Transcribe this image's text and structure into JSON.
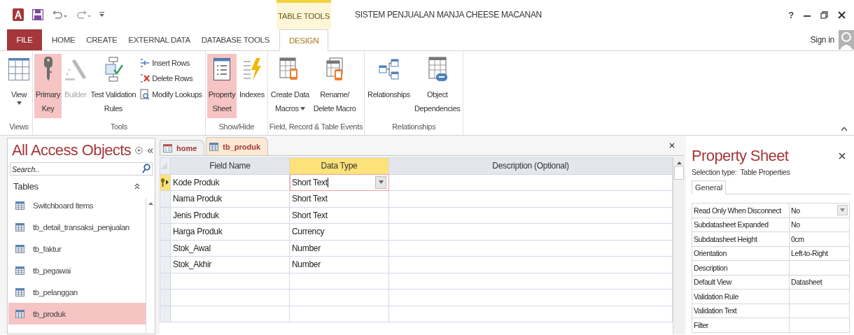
{
  "title_bar": {
    "contextual_tab": "TABLE TOOLS",
    "title": "SISTEM PENJUALAN MANJA CHEESE MACANAN",
    "help": "?"
  },
  "tabs": [
    {
      "label": "FILE",
      "kind": "file",
      "selected": false
    },
    {
      "label": "HOME",
      "kind": "tab",
      "selected": false
    },
    {
      "label": "CREATE",
      "kind": "tab",
      "selected": false
    },
    {
      "label": "EXTERNAL DATA",
      "kind": "tab",
      "selected": false
    },
    {
      "label": "DATABASE TOOLS",
      "kind": "tab",
      "selected": false
    },
    {
      "label": "DESIGN",
      "kind": "tab",
      "selected": true
    }
  ],
  "sign_in": "Sign in",
  "ribbon": {
    "groups": [
      {
        "label": "Views",
        "commands": [
          {
            "kind": "large",
            "lines": [
              "View"
            ],
            "dropdown": true,
            "on": false,
            "disabled": false
          }
        ]
      },
      {
        "label": "Tools",
        "commands": [
          {
            "kind": "large",
            "lines": [
              "Primary",
              "Key"
            ],
            "dropdown": false,
            "on": true,
            "disabled": false
          },
          {
            "kind": "large",
            "lines": [
              "Builder"
            ],
            "dropdown": false,
            "on": false,
            "disabled": true
          },
          {
            "kind": "large",
            "lines": [
              "Test Validation",
              "Rules"
            ],
            "dropdown": false,
            "on": false,
            "disabled": false
          },
          {
            "kind": "small",
            "lines": [
              "Insert Rows"
            ],
            "dropdown": false,
            "on": false,
            "disabled": false
          },
          {
            "kind": "small",
            "lines": [
              "Delete Rows"
            ],
            "dropdown": false,
            "on": false,
            "disabled": false
          },
          {
            "kind": "small",
            "lines": [
              "Modify Lookups"
            ],
            "dropdown": false,
            "on": false,
            "disabled": false
          }
        ]
      },
      {
        "label": "Show/Hide",
        "commands": [
          {
            "kind": "large",
            "lines": [
              "Property",
              "Sheet"
            ],
            "dropdown": false,
            "on": true,
            "disabled": false
          },
          {
            "kind": "large",
            "lines": [
              "Indexes"
            ],
            "dropdown": false,
            "on": false,
            "disabled": false
          }
        ]
      },
      {
        "label": "Field, Record & Table Events",
        "commands": [
          {
            "kind": "large",
            "lines": [
              "Create Data",
              "Macros"
            ],
            "dropdown": true,
            "on": false,
            "disabled": false
          },
          {
            "kind": "large",
            "lines": [
              "Rename/",
              "Delete Macro"
            ],
            "dropdown": false,
            "on": false,
            "disabled": false
          }
        ]
      },
      {
        "label": "Relationships",
        "commands": [
          {
            "kind": "large",
            "lines": [
              "Relationships"
            ],
            "dropdown": false,
            "on": false,
            "disabled": false
          },
          {
            "kind": "large",
            "lines": [
              "Object",
              "Dependencies"
            ],
            "dropdown": false,
            "on": false,
            "disabled": false
          }
        ]
      }
    ]
  },
  "nav_pane": {
    "title": "All Access Objects",
    "search": {
      "placeholder": "Search.."
    },
    "section": "Tables",
    "items": [
      {
        "label": "Switchboard Items",
        "selected": false
      },
      {
        "label": "tb_detail_transaksi_penjualan",
        "selected": false
      },
      {
        "label": "tb_faktur",
        "selected": false
      },
      {
        "label": "tb_pegawai",
        "selected": false
      },
      {
        "label": "tb_pelanggan",
        "selected": false
      },
      {
        "label": "tb_produk",
        "selected": true
      }
    ]
  },
  "document_tabs": [
    {
      "label": "home",
      "kind": "form",
      "selected": false
    },
    {
      "label": "tb_produk",
      "kind": "table",
      "selected": true
    }
  ],
  "design_grid": {
    "columns": [
      {
        "label": "Field Name",
        "selected": false
      },
      {
        "label": "Data Type",
        "selected": true
      },
      {
        "label": "Description (Optional)",
        "selected": false
      }
    ],
    "rows": [
      {
        "field_name": "Kode Produk",
        "data_type": "Short Text",
        "primary_key": true,
        "current": true
      },
      {
        "field_name": "Nama Produk",
        "data_type": "Short Text",
        "primary_key": false,
        "current": false
      },
      {
        "field_name": "Jenis Produk",
        "data_type": "Short Text",
        "primary_key": false,
        "current": false
      },
      {
        "field_name": "Harga Produk",
        "data_type": "Currency",
        "primary_key": false,
        "current": false
      },
      {
        "field_name": "Stok_Awal",
        "data_type": "Number",
        "primary_key": false,
        "current": false
      },
      {
        "field_name": "Stok_Akhir",
        "data_type": "Number",
        "primary_key": false,
        "current": false
      }
    ]
  },
  "property_sheet": {
    "title": "Property Sheet",
    "selection_label": "Selection type:",
    "selection_value": "Table Properties",
    "tabs": [
      {
        "label": "General",
        "selected": true
      }
    ],
    "properties": [
      {
        "name": "Read Only When Disconnect",
        "value": "No",
        "dropdown": true
      },
      {
        "name": "Subdatasheet Expanded",
        "value": "No",
        "dropdown": false
      },
      {
        "name": "Subdatasheet Height",
        "value": "0cm",
        "dropdown": false
      },
      {
        "name": "Orientation",
        "value": "Left-to-Right",
        "dropdown": false
      },
      {
        "name": "Description",
        "dropdown": false
      },
      {
        "name": "Default View",
        "value": "Datasheet",
        "dropdown": false
      },
      {
        "name": "Validation Rule",
        "dropdown": false
      },
      {
        "name": "Validation Text",
        "dropdown": false
      },
      {
        "name": "Filter",
        "dropdown": false
      }
    ]
  }
}
